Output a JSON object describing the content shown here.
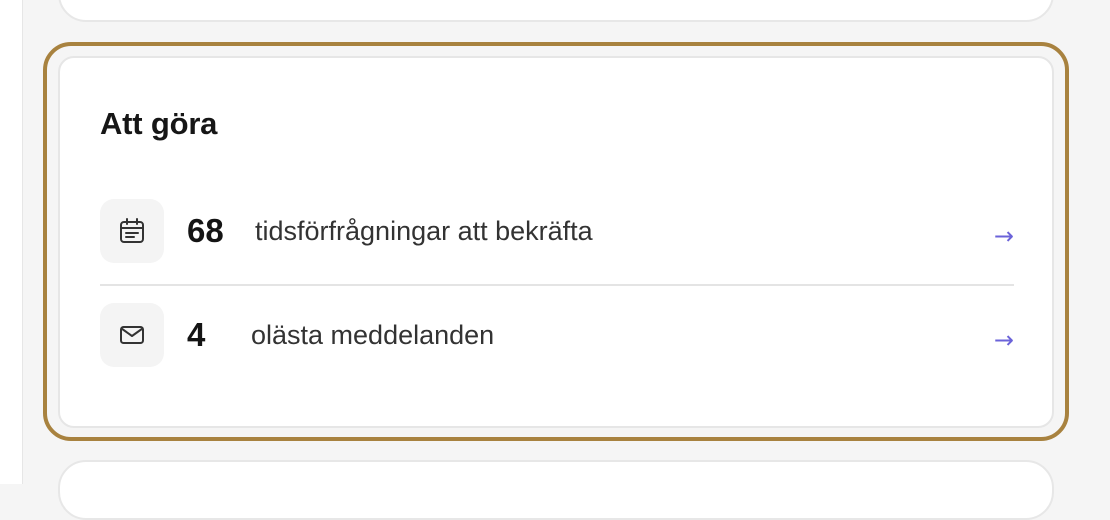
{
  "todo": {
    "title": "Att göra",
    "items": [
      {
        "icon": "calendar-icon",
        "count": "68",
        "label": "tidsförfrågningar att bekräfta",
        "arrow": "→"
      },
      {
        "icon": "mail-icon",
        "count": "4",
        "label": "olästa meddelanden",
        "arrow": "→"
      }
    ]
  },
  "colors": {
    "highlight_border": "#a8823f",
    "arrow": "#6b63d9",
    "icon_background": "#f4f4f4",
    "page_background": "#f5f5f5"
  }
}
